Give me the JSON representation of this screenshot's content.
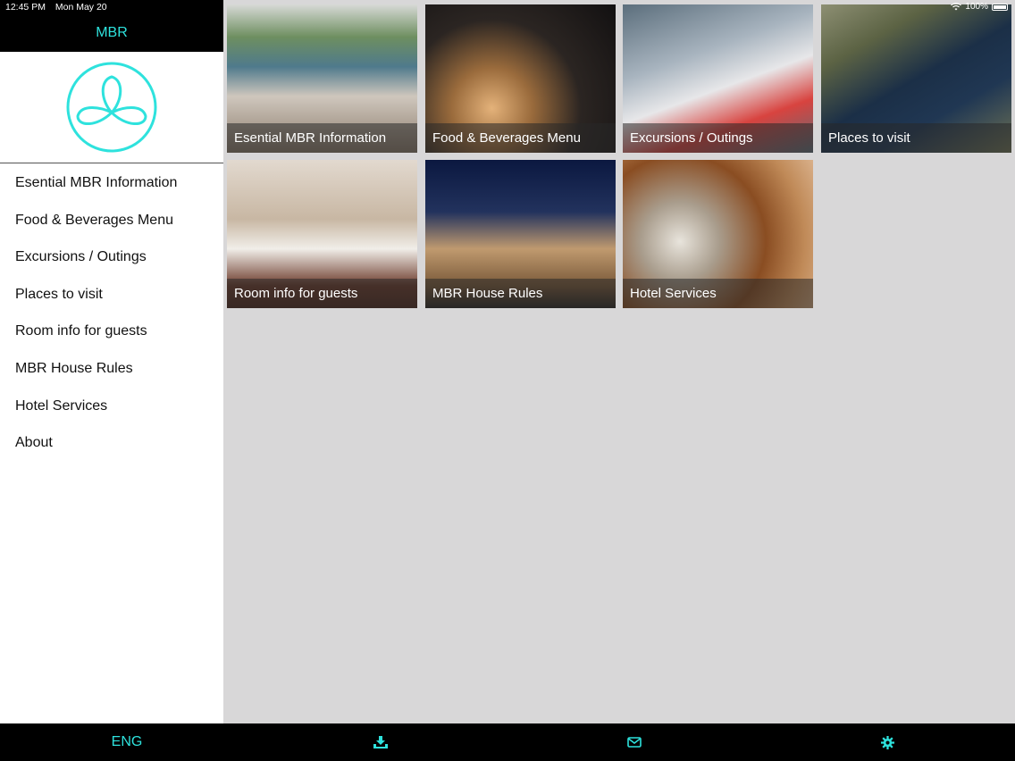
{
  "status": {
    "time": "12:45 PM",
    "date": "Mon May 20",
    "battery": "100%"
  },
  "app": {
    "title": "MBR"
  },
  "menu": {
    "items": [
      {
        "label": "Esential MBR Information"
      },
      {
        "label": "Food & Beverages Menu"
      },
      {
        "label": "Excursions / Outings"
      },
      {
        "label": "Places to visit"
      },
      {
        "label": "Room info for guests"
      },
      {
        "label": "MBR House Rules"
      },
      {
        "label": "Hotel Services"
      },
      {
        "label": "About"
      }
    ]
  },
  "tiles": [
    {
      "caption": "Esential MBR Information"
    },
    {
      "caption": "Food & Beverages Menu"
    },
    {
      "caption": "Excursions / Outings"
    },
    {
      "caption": "Places to visit"
    },
    {
      "caption": "Room info for guests"
    },
    {
      "caption": "MBR House Rules"
    },
    {
      "caption": "Hotel Services"
    }
  ],
  "bottom_bar": {
    "language": "ENG",
    "icons": [
      "download-icon",
      "mail-icon",
      "gear-icon"
    ]
  },
  "colors": {
    "accent": "#2ee2dd",
    "header_bg": "#000000",
    "content_bg": "#d8d7d8"
  }
}
